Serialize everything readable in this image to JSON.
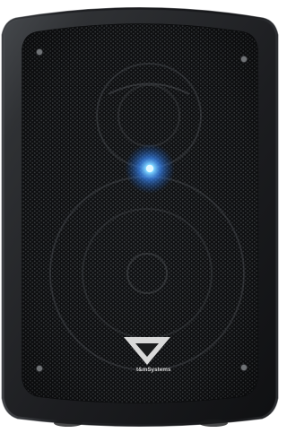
{
  "product": {
    "brand_label": "t&mSystems",
    "led_color": "#4fb7ff"
  },
  "colors": {
    "cabinet": "#2a2b2d",
    "cabinet_edge": "#121314",
    "grille": "#101112",
    "mesh_highlight": "#3b3d40",
    "screw": "#6f7275",
    "logo": "#d9d9d9",
    "background": "#ffffff"
  },
  "icons": {
    "logo": "triangle-logo-icon",
    "led": "power-led-icon",
    "screw": "screw-icon"
  }
}
